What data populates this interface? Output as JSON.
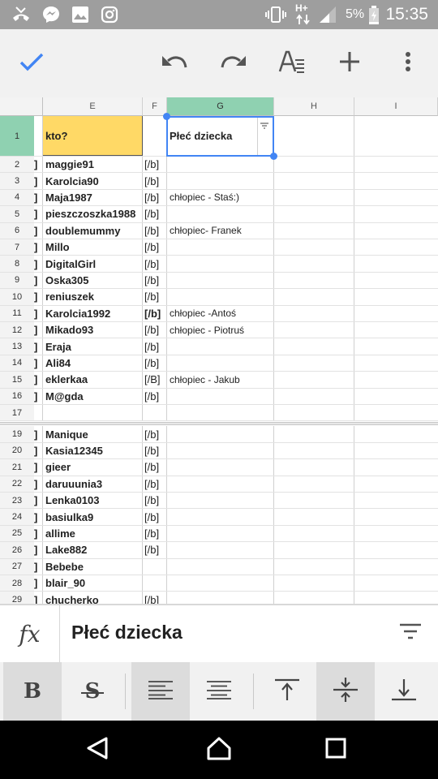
{
  "status_bar": {
    "icons": [
      "missed-call-icon",
      "messenger-icon",
      "gallery-icon",
      "instagram-icon",
      "vibrate-icon",
      "network-hplus-icon",
      "signal-icon",
      "battery-icon"
    ],
    "network_label": "H+",
    "battery_pct": "5%",
    "time": "15:35"
  },
  "toolbar": {
    "buttons": [
      "check-icon",
      "undo-icon",
      "redo-icon",
      "text-format-icon",
      "add-icon",
      "more-vert-icon"
    ],
    "accent": "#4285f4"
  },
  "grid": {
    "columns": [
      "E",
      "F",
      "G",
      "H",
      "I"
    ],
    "selected_column": "G",
    "header_row": {
      "num": "1",
      "E": "kto?",
      "F": "",
      "G": "Płeć dziecka"
    },
    "rows": [
      {
        "num": "2",
        "D": "]",
        "E": "maggie91",
        "F": "[/b]",
        "G": ""
      },
      {
        "num": "3",
        "D": "]",
        "E": "Karolcia90",
        "F": "[/b]",
        "G": ""
      },
      {
        "num": "4",
        "D": "]",
        "E": "Maja1987",
        "F": "[/b]",
        "G": "chłopiec - Staś:)"
      },
      {
        "num": "5",
        "D": "]",
        "E": "pieszczoszka1988",
        "F": "[/b]",
        "G": ""
      },
      {
        "num": "6",
        "D": "]",
        "E": "doublemummy",
        "F": "[/b]",
        "G": "chłopiec- Franek"
      },
      {
        "num": "7",
        "D": "]",
        "E": "Millo",
        "F": "[/b]",
        "G": ""
      },
      {
        "num": "8",
        "D": "]",
        "E": "DigitalGirl",
        "F": "[/b]",
        "G": ""
      },
      {
        "num": "9",
        "D": "]",
        "E": "Oska305",
        "F": "[/b]",
        "G": ""
      },
      {
        "num": "10",
        "D": "]",
        "E": "reniuszek",
        "F": "[/b]",
        "G": ""
      },
      {
        "num": "11",
        "D": "]",
        "E": "Karolcia1992",
        "F": "[/b]",
        "G": "chłopiec -Antoś",
        "F_bold": true
      },
      {
        "num": "12",
        "D": "]",
        "E": "Mikado93",
        "F": "[/b]",
        "G": "chłopiec - Piotruś"
      },
      {
        "num": "13",
        "D": "]",
        "E": "Eraja",
        "F": "[/b]",
        "G": ""
      },
      {
        "num": "14",
        "D": "]",
        "E": "Ali84",
        "F": "[/b]",
        "G": ""
      },
      {
        "num": "15",
        "D": "]",
        "E": "eklerkaa",
        "F": "[/B]",
        "G": "chłopiec - Jakub"
      },
      {
        "num": "16",
        "D": "]",
        "E": "M@gda",
        "F": "[/b]",
        "G": ""
      },
      {
        "num": "17",
        "D": "",
        "E": "",
        "F": "",
        "G": ""
      },
      {
        "num": "19",
        "D": "]",
        "E": "Manique",
        "F": "[/b]",
        "G": ""
      },
      {
        "num": "20",
        "D": "]",
        "E": "Kasia12345",
        "F": "[/b]",
        "G": ""
      },
      {
        "num": "21",
        "D": "]",
        "E": "gieer",
        "F": "[/b]",
        "G": ""
      },
      {
        "num": "22",
        "D": "]",
        "E": "daruuunia3",
        "F": "[/b]",
        "G": ""
      },
      {
        "num": "23",
        "D": "]",
        "E": "Lenka0103",
        "F": "[/b]",
        "G": ""
      },
      {
        "num": "24",
        "D": "]",
        "E": "basiulka9",
        "F": "[/b]",
        "G": ""
      },
      {
        "num": "25",
        "D": "]",
        "E": "allime",
        "F": "[/b]",
        "G": ""
      },
      {
        "num": "26",
        "D": "]",
        "E": "Lake882",
        "F": "[/b]",
        "G": ""
      },
      {
        "num": "27",
        "D": "]",
        "E": "Bebebe",
        "F": "",
        "G": ""
      },
      {
        "num": "28",
        "D": "]",
        "E": "blair_90",
        "F": "",
        "G": ""
      },
      {
        "num": "29",
        "D": "]",
        "E": "chucherko",
        "F": "[/b]",
        "G": ""
      }
    ]
  },
  "formula_bar": {
    "icon": "fx-icon",
    "fx_label": "fx",
    "value": "Płeć dziecka",
    "filter_icon": "filter-icon"
  },
  "format_bar": {
    "buttons": [
      "bold-icon",
      "strikethrough-icon",
      "align-left-icon",
      "align-center-icon",
      "valign-top-icon",
      "valign-middle-icon",
      "valign-bottom-icon"
    ],
    "bold_label": "B",
    "strike_label": "S"
  },
  "nav_bar": {
    "buttons": [
      "back-icon",
      "home-icon",
      "recents-icon"
    ]
  }
}
